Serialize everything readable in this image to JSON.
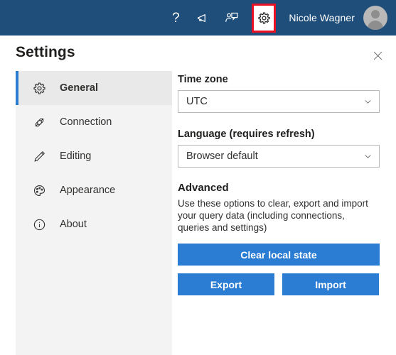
{
  "topbar": {
    "icons": [
      {
        "name": "help-icon",
        "glyph": "?"
      },
      {
        "name": "megaphone-icon",
        "glyph": ""
      },
      {
        "name": "feedback-icon",
        "glyph": ""
      }
    ],
    "settings_icon_name": "gear-icon",
    "username": "Nicole Wagner",
    "avatar_name": "user-avatar",
    "background_color": "#1e4e79",
    "highlight_color": "#e81123"
  },
  "panel": {
    "title": "Settings",
    "close_label": "✕"
  },
  "sidebar": {
    "items": [
      {
        "label": "General",
        "icon": "gear-icon",
        "selected": true
      },
      {
        "label": "Connection",
        "icon": "plug-icon",
        "selected": false
      },
      {
        "label": "Editing",
        "icon": "pencil-icon",
        "selected": false
      },
      {
        "label": "Appearance",
        "icon": "palette-icon",
        "selected": false
      },
      {
        "label": "About",
        "icon": "info-icon",
        "selected": false
      }
    ],
    "accent_color": "#2b7cd3",
    "background_color": "#f3f3f3"
  },
  "general": {
    "timezone_label": "Time zone",
    "timezone_value": "UTC",
    "language_label": "Language (requires refresh)",
    "language_value": "Browser default",
    "advanced_title": "Advanced",
    "advanced_description": "Use these options to clear, export and import your query data (including connections, queries and settings)",
    "clear_button": "Clear local state",
    "export_button": "Export",
    "import_button": "Import",
    "button_color": "#2b7cd3"
  }
}
